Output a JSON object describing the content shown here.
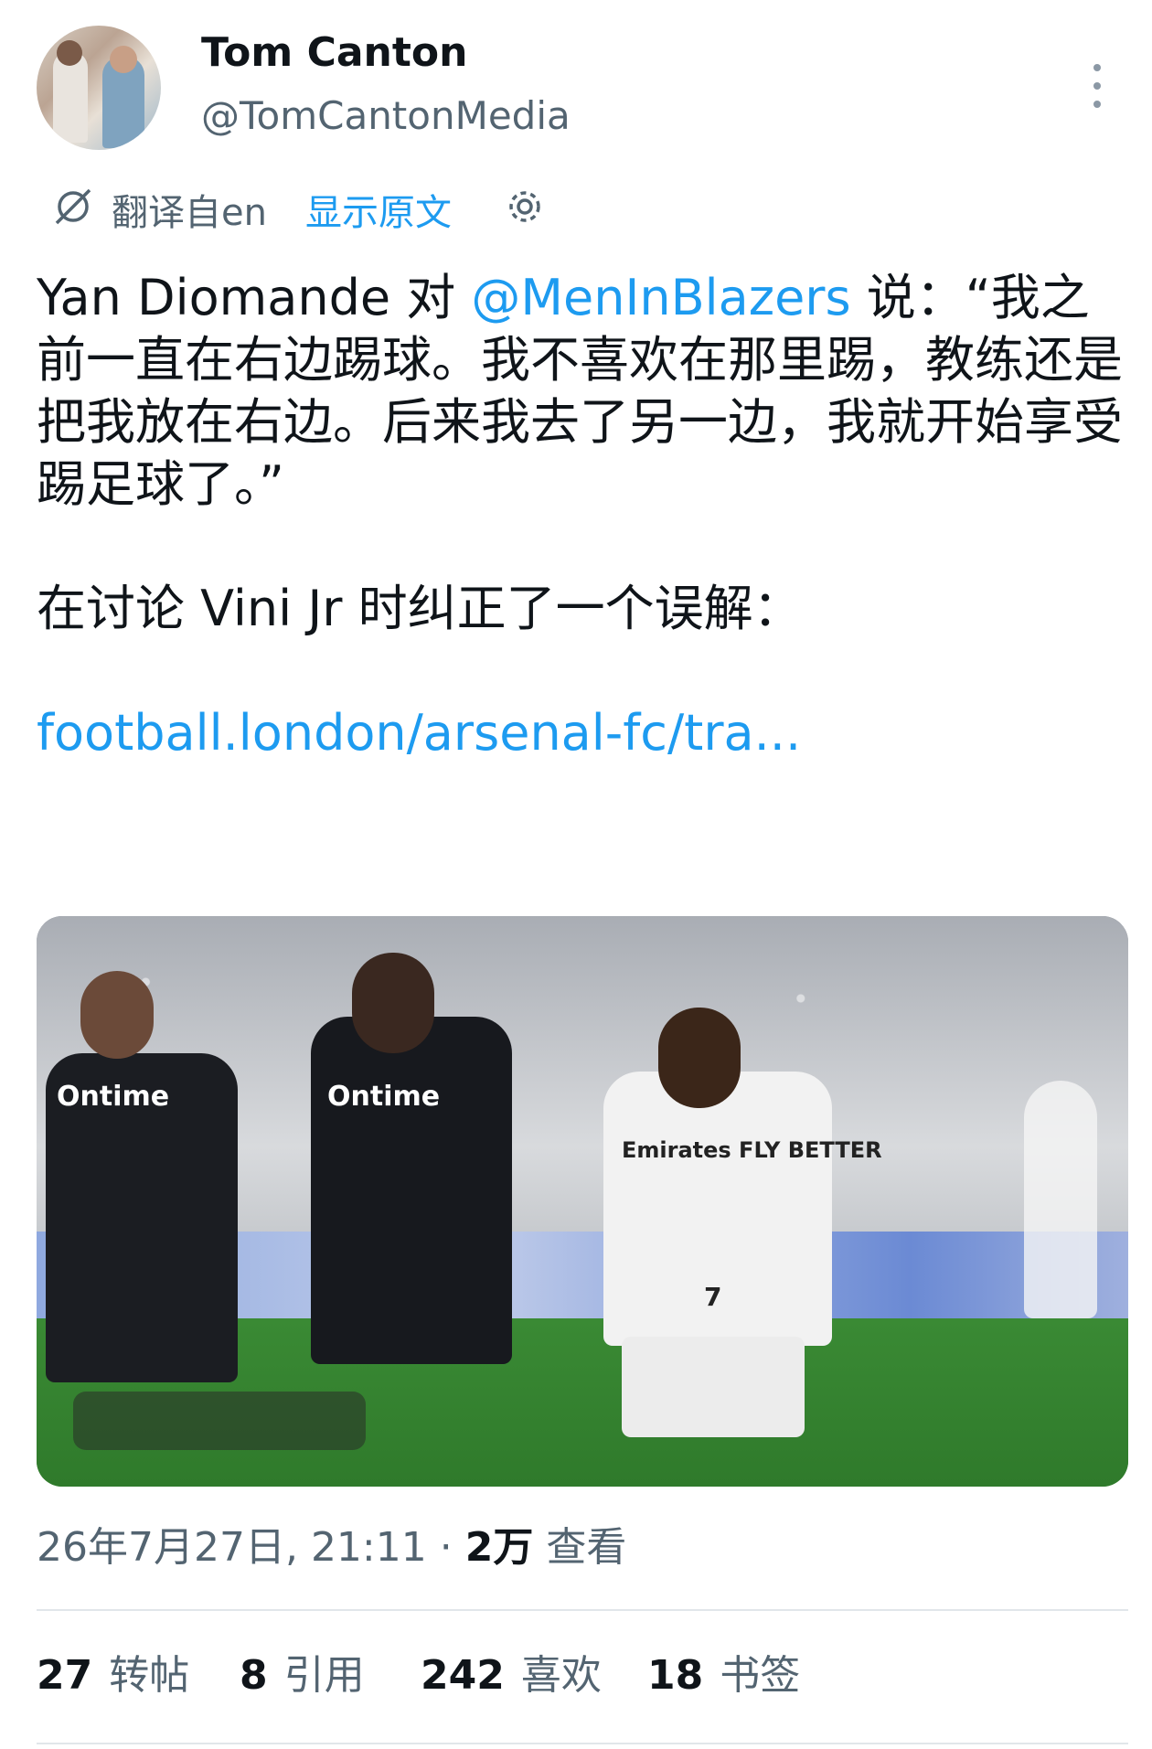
{
  "author": {
    "name": "Tom Canton",
    "handle": "@TomCantonMedia"
  },
  "translation": {
    "from_label": "翻译自en",
    "show_original_label": "显示原文"
  },
  "tweet": {
    "line1_prefix": "Yan Diomande 对 ",
    "mention": "@MenInBlazers",
    "line1_suffix": " 说：“我之前一直在右边踢球。我不喜欢在那里踢，教练还是把我放在右边。后来我去了另一边，我就开始享受踢足球了。”",
    "paragraph2": "在讨论 Vini Jr 时纠正了一个误解：",
    "link": "football.london/arsenal-fc/tra..."
  },
  "photo": {
    "shirt_sponsor_1": "Ontime",
    "shirt_sponsor_2": "Ontime",
    "shirt_sponsor_3": "Emirates FLY BETTER",
    "number": "7"
  },
  "meta": {
    "datetime": "26年7月27日, 21:11 · ",
    "views_count": "2万",
    "views_label": " 查看"
  },
  "stats": {
    "retweets_count": "27",
    "retweets_label": "转帖",
    "quotes_count": "8",
    "quotes_label": "引用",
    "likes_count": "242",
    "likes_label": "喜欢",
    "bookmarks_count": "18",
    "bookmarks_label": "书签"
  }
}
